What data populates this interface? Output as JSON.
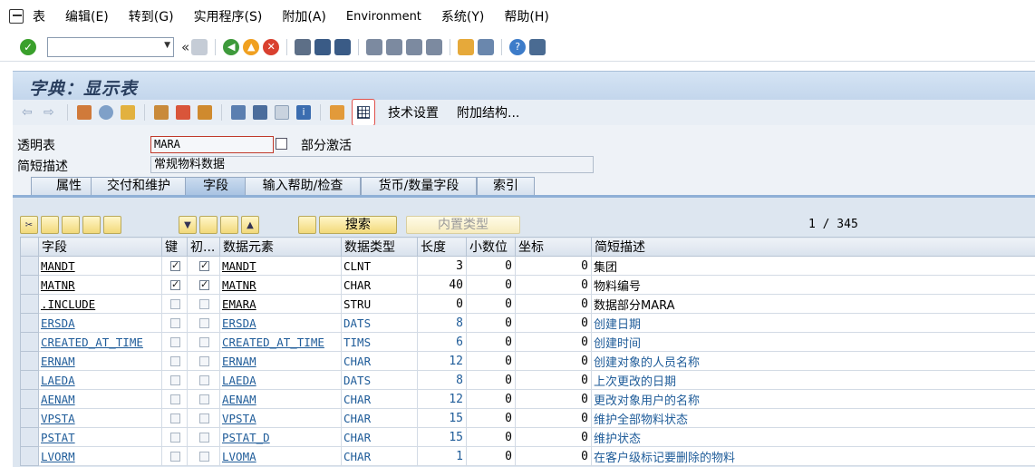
{
  "menu": {
    "items": [
      "表",
      "编辑(E)",
      "转到(G)",
      "实用程序(S)",
      "附加(A)",
      "Environment",
      "系统(Y)",
      "帮助(H)"
    ]
  },
  "toolbar": {
    "command_value": "",
    "collapse_glyph": "«"
  },
  "title": "字典：显示表",
  "app_toolbar": {
    "tech_settings": "技术设置",
    "append_structure": "附加结构..."
  },
  "header": {
    "transparent_table_label": "透明表",
    "transparent_table_value": "MARA",
    "status": "部分激活",
    "short_desc_label": "简短描述",
    "short_desc_value": "常规物料数据"
  },
  "tabs": [
    "属性",
    "交付和维护",
    "字段",
    "输入帮助/检查",
    "货币/数量字段",
    "索引"
  ],
  "active_tab": "字段",
  "table_toolbar": {
    "search_label": "搜索",
    "builtin_type_label": "内置类型",
    "counter": "1 / 345"
  },
  "columns": [
    "字段",
    "键",
    "初...",
    "数据元素",
    "数据类型",
    "长度",
    "小数位",
    "坐标",
    "简短描述"
  ],
  "rows": [
    {
      "field": "MANDT",
      "key": true,
      "init": true,
      "element": "MANDT",
      "type": "CLNT",
      "length": "3",
      "dec": "0",
      "coord": "0",
      "desc": "集团",
      "link": false
    },
    {
      "field": "MATNR",
      "key": true,
      "init": true,
      "element": "MATNR",
      "type": "CHAR",
      "length": "40",
      "dec": "0",
      "coord": "0",
      "desc": "物料编号",
      "link": false
    },
    {
      "field": ".INCLUDE",
      "key": false,
      "init": false,
      "element": "EMARA",
      "type": "STRU",
      "length": "0",
      "dec": "0",
      "coord": "0",
      "desc": "数据部分MARA",
      "link": false
    },
    {
      "field": "ERSDA",
      "key": false,
      "init": false,
      "element": "ERSDA",
      "type": "DATS",
      "length": "8",
      "dec": "0",
      "coord": "0",
      "desc": "创建日期",
      "link": true
    },
    {
      "field": "CREATED_AT_TIME",
      "key": false,
      "init": false,
      "element": "CREATED_AT_TIME",
      "type": "TIMS",
      "length": "6",
      "dec": "0",
      "coord": "0",
      "desc": "创建时间",
      "link": true
    },
    {
      "field": "ERNAM",
      "key": false,
      "init": false,
      "element": "ERNAM",
      "type": "CHAR",
      "length": "12",
      "dec": "0",
      "coord": "0",
      "desc": "创建对象的人员名称",
      "link": true
    },
    {
      "field": "LAEDA",
      "key": false,
      "init": false,
      "element": "LAEDA",
      "type": "DATS",
      "length": "8",
      "dec": "0",
      "coord": "0",
      "desc": "上次更改的日期",
      "link": true
    },
    {
      "field": "AENAM",
      "key": false,
      "init": false,
      "element": "AENAM",
      "type": "CHAR",
      "length": "12",
      "dec": "0",
      "coord": "0",
      "desc": "更改对象用户的名称",
      "link": true
    },
    {
      "field": "VPSTA",
      "key": false,
      "init": false,
      "element": "VPSTA",
      "type": "CHAR",
      "length": "15",
      "dec": "0",
      "coord": "0",
      "desc": "维护全部物料状态",
      "link": true
    },
    {
      "field": "PSTAT",
      "key": false,
      "init": false,
      "element": "PSTAT_D",
      "type": "CHAR",
      "length": "15",
      "dec": "0",
      "coord": "0",
      "desc": "维护状态",
      "link": true
    },
    {
      "field": "LVORM",
      "key": false,
      "init": false,
      "element": "LVOMA",
      "type": "CHAR",
      "length": "1",
      "dec": "0",
      "coord": "0",
      "desc": "在客户级标记要删除的物料",
      "link": true
    }
  ]
}
